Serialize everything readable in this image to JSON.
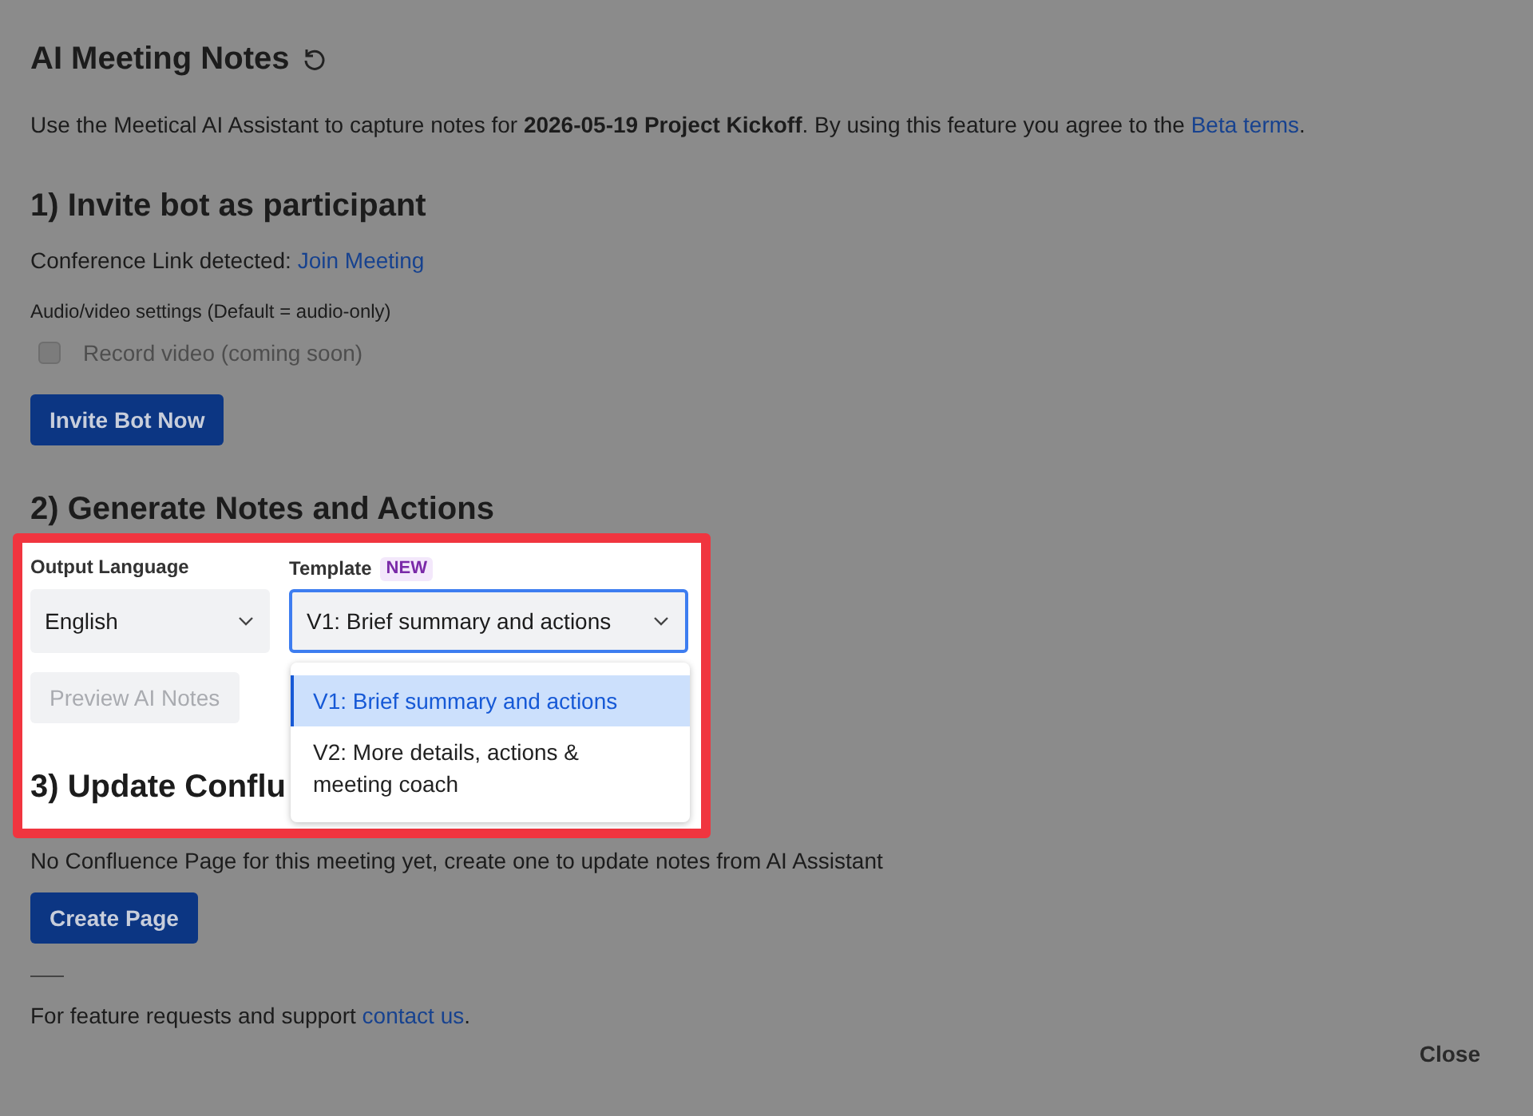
{
  "title": "AI Meeting Notes",
  "intro": {
    "text": "Use the Meetical AI Assistant to capture notes for **2026-05-19 Project Kickoff**. By using this feature you agree to the ",
    "link": "Beta terms",
    "end": "."
  },
  "section_1": {
    "heading": "1) Invite bot as participant",
    "conference_label": "Conference Link detected: ",
    "conference_link": "Join Meeting",
    "settings_label": "Audio/video settings (Default = audio-only)",
    "record_video": {
      "label": "Record video (coming soon)",
      "checked": false,
      "disabled": true
    },
    "button": "Invite Bot Now"
  },
  "section_2": {
    "heading": "2) Generate Notes and Actions",
    "output_language": {
      "label": "Output Language",
      "value": "English"
    },
    "template": {
      "label": "Template",
      "badge": "NEW",
      "value": "V1: Brief summary and actions",
      "expanded": true,
      "options": [
        {
          "label": "V1: Brief summary and actions",
          "selected": true
        },
        {
          "label": "V2: More details, actions & meeting coach",
          "selected": false
        }
      ]
    },
    "preview_button": {
      "label": "Preview AI Notes",
      "disabled": true
    }
  },
  "section_3": {
    "heading": "3) Update Conflu",
    "text": "No Confluence Page for this meeting yet, create one to update notes from AI Assistant",
    "button": "Create Page"
  },
  "footer": {
    "text": "For feature requests and support ",
    "link": "contact us",
    "end": "."
  },
  "close_button": "Close"
}
